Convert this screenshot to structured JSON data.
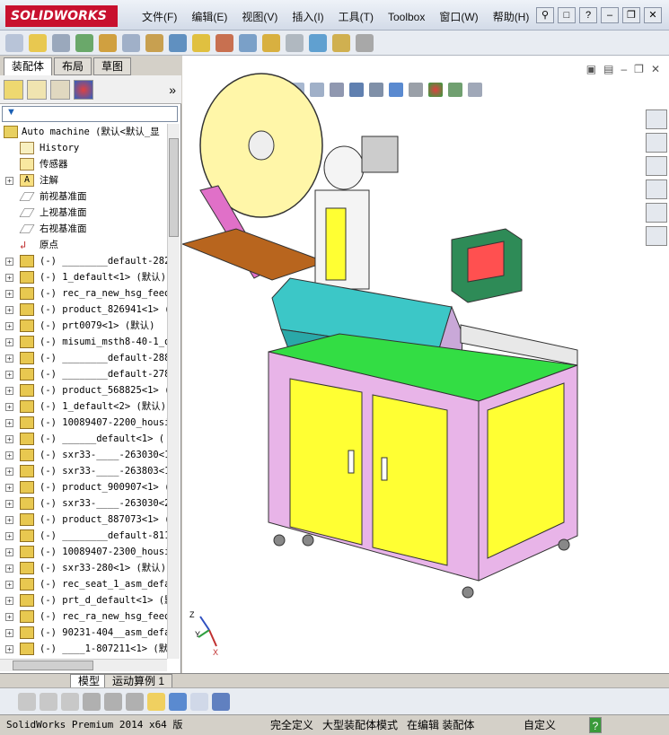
{
  "app": {
    "logo": "SOLIDWORKS"
  },
  "menu": [
    "文件(F)",
    "编辑(E)",
    "视图(V)",
    "插入(I)",
    "工具(T)",
    "Toolbox",
    "窗口(W)",
    "帮助(H)"
  ],
  "panel_tabs": [
    "装配体",
    "布局",
    "草图"
  ],
  "tree": {
    "root": "Auto machine  (默认<默认_显",
    "fixed": [
      "History",
      "传感器",
      "注解",
      "前视基准面",
      "上视基准面",
      "右视基准面",
      "原点"
    ],
    "components": [
      "(-) ________default-282",
      "(-) 1_default<1> (默认)",
      "(-) rec_ra_new_hsg_feede",
      "(-) product_826941<1> (",
      "(-) prt0079<1> (默认)",
      "(-) misumi_msth8-40-1_de",
      "(-) ________default-288",
      "(-) ________default-278",
      "(-) product_568825<1> (",
      "(-) 1_default<2> (默认)",
      "(-) 10089407-2200_housir",
      "(-) ______default<1> (",
      "(-) sxr33-____-263030<1>",
      "(-) sxr33-____-263803<1>",
      "(-) product_900907<1> (",
      "(-) sxr33-____-263030<2>",
      "(-) product_887073<1> (",
      "(-) ________default-811",
      "(-) 10089407-2300_housir",
      "(-) sxr33-280<1> (默认)",
      "(-) rec_seat_1_asm_defau",
      "(-) prt_d_default<1> (默",
      "(-) rec_ra_new_hsg_feede",
      "(-) 90231-404__asm_defau",
      "(-) ____1-807211<1> (默认"
    ]
  },
  "bottom_tabs": [
    "模型",
    "运动算例 1"
  ],
  "status": {
    "product": "SolidWorks Premium 2014 x64 版",
    "constraint": "完全定义",
    "mode": "大型装配体模式",
    "editing": "在编辑 装配体",
    "custom": "自定义"
  },
  "triad": {
    "x": "X",
    "y": "Y",
    "z": "Z"
  },
  "colors": {
    "accent": "#c8102e",
    "frame": "#e8b4e8",
    "panel_yellow": "#ffff33",
    "teal": "#3cc7c7",
    "green": "#2e8b57",
    "brown": "#b8651e"
  }
}
